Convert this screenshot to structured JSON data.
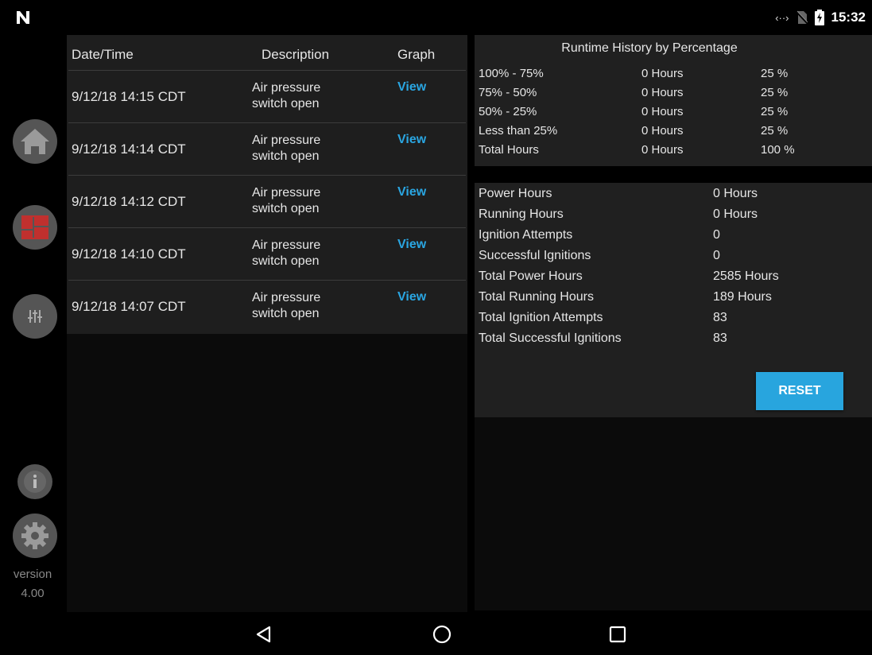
{
  "status_bar": {
    "time": "15:32",
    "icons": [
      "n-logo-icon",
      "code-icon",
      "no-sim-icon",
      "battery-charging-icon"
    ]
  },
  "sidebar": {
    "buttons": [
      {
        "name": "home",
        "icon": "home-icon"
      },
      {
        "name": "dashboard",
        "icon": "grid-icon"
      },
      {
        "name": "settings-sliders",
        "icon": "sliders-icon"
      },
      {
        "name": "info",
        "icon": "info-icon"
      },
      {
        "name": "settings",
        "icon": "gear-icon"
      }
    ],
    "version_label": "version",
    "version_number": "4.00"
  },
  "events": {
    "headers": {
      "date": "Date/Time",
      "description": "Description",
      "graph": "Graph"
    },
    "rows": [
      {
        "date": "9/12/18 14:15 CDT",
        "desc1": "Air pressure",
        "desc2": "switch open",
        "link": "View"
      },
      {
        "date": "9/12/18 14:14 CDT",
        "desc1": "Air pressure",
        "desc2": "switch open",
        "link": "View"
      },
      {
        "date": "9/12/18 14:12 CDT",
        "desc1": "Air pressure",
        "desc2": "switch open",
        "link": "View"
      },
      {
        "date": "9/12/18 14:10 CDT",
        "desc1": "Air pressure",
        "desc2": "switch open",
        "link": "View"
      },
      {
        "date": "9/12/18 14:07 CDT",
        "desc1": "Air pressure",
        "desc2": "switch open",
        "link": "View"
      }
    ]
  },
  "runtime": {
    "title": "Runtime History by Percentage",
    "rows": [
      {
        "range": "100% - 75%",
        "hours": "0 Hours",
        "percent": "25 %"
      },
      {
        "range": "75% - 50%",
        "hours": "0 Hours",
        "percent": "25 %"
      },
      {
        "range": "50% - 25%",
        "hours": "0 Hours",
        "percent": "25 %"
      },
      {
        "range": "Less than 25%",
        "hours": "0 Hours",
        "percent": "25 %"
      },
      {
        "range": "Total Hours",
        "hours": "0 Hours",
        "percent": "100 %"
      }
    ]
  },
  "stats": {
    "rows": [
      {
        "label": "Power Hours",
        "value": "0 Hours"
      },
      {
        "label": "Running Hours",
        "value": "0 Hours"
      },
      {
        "label": "Ignition Attempts",
        "value": "0"
      },
      {
        "label": "Successful Ignitions",
        "value": "0"
      },
      {
        "label": "Total Power Hours",
        "value": "2585 Hours"
      },
      {
        "label": "Total Running Hours",
        "value": "189 Hours"
      },
      {
        "label": "Total Ignition Attempts",
        "value": "83"
      },
      {
        "label": "Total Successful Ignitions",
        "value": "83"
      }
    ],
    "reset_label": "RESET"
  },
  "nav": {
    "buttons": [
      "back-icon",
      "home-circle-icon",
      "recents-icon"
    ]
  },
  "colors": {
    "accent": "#2aa6e2",
    "button": "#28a5de",
    "dashboard_red": "#c0302e"
  }
}
